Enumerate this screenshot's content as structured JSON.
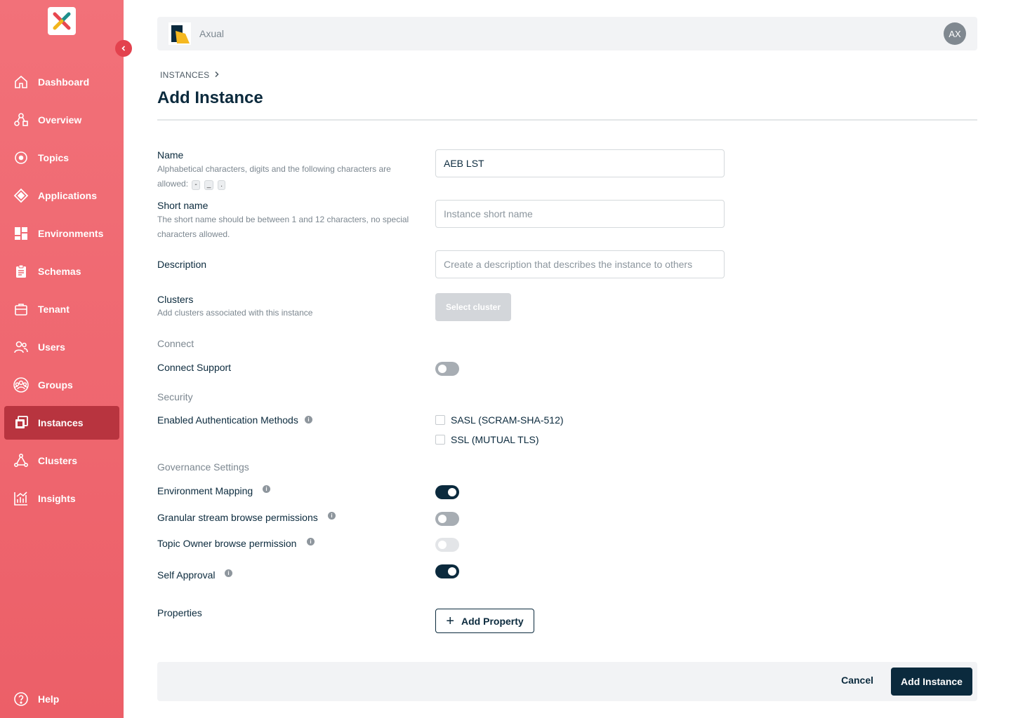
{
  "app": {
    "org_name": "Axual",
    "avatar_initials": "AX",
    "brand_color": "#ec5f68",
    "active_color": "#b8343f",
    "primary_color": "#0b2a3d"
  },
  "sidebar": {
    "items": [
      {
        "label": "Dashboard",
        "icon": "home-icon"
      },
      {
        "label": "Overview",
        "icon": "overview-icon"
      },
      {
        "label": "Topics",
        "icon": "topic-icon"
      },
      {
        "label": "Applications",
        "icon": "application-icon"
      },
      {
        "label": "Environments",
        "icon": "grid-icon"
      },
      {
        "label": "Schemas",
        "icon": "clipboard-icon"
      },
      {
        "label": "Tenant",
        "icon": "briefcase-icon"
      },
      {
        "label": "Users",
        "icon": "users-icon"
      },
      {
        "label": "Groups",
        "icon": "groups-icon"
      },
      {
        "label": "Instances",
        "icon": "instances-icon",
        "active": true
      },
      {
        "label": "Clusters",
        "icon": "cluster-icon"
      },
      {
        "label": "Insights",
        "icon": "insights-icon"
      }
    ],
    "help_label": "Help"
  },
  "breadcrumb": {
    "parent": "INSTANCES"
  },
  "page_title": "Add Instance",
  "form": {
    "name": {
      "label": "Name",
      "help_prefix": "Alphabetical characters, digits and the following characters are allowed:",
      "chips": [
        "-",
        "_",
        "."
      ],
      "value": "AEB LST",
      "placeholder": ""
    },
    "short_name": {
      "label": "Short name",
      "help": "The short name should be between 1 and 12 characters, no special characters allowed.",
      "placeholder": "Instance short name"
    },
    "description": {
      "label": "Description",
      "placeholder": "Create a description that describes the instance to others"
    },
    "clusters": {
      "label": "Clusters",
      "help": "Add clusters associated with this instance",
      "button": "Select cluster"
    },
    "connect": {
      "section": "Connect",
      "label": "Connect Support",
      "enabled": false
    },
    "security": {
      "section": "Security",
      "label": "Enabled Authentication Methods",
      "options": [
        "SASL (SCRAM-SHA-512)",
        "SSL (MUTUAL TLS)"
      ],
      "checked": [
        false,
        false
      ]
    },
    "governance": {
      "section": "Governance Settings",
      "env_mapping": {
        "label": "Environment Mapping",
        "enabled": true
      },
      "granular_browse": {
        "label": "Granular stream browse permissions",
        "enabled": false
      },
      "owner_browse": {
        "label": "Topic Owner browse permission",
        "enabled": false,
        "disabled": true
      },
      "self_approval": {
        "label": "Self Approval",
        "enabled": true
      }
    },
    "properties": {
      "label": "Properties",
      "button": "Add Property"
    }
  },
  "footer": {
    "cancel": "Cancel",
    "submit": "Add Instance"
  }
}
